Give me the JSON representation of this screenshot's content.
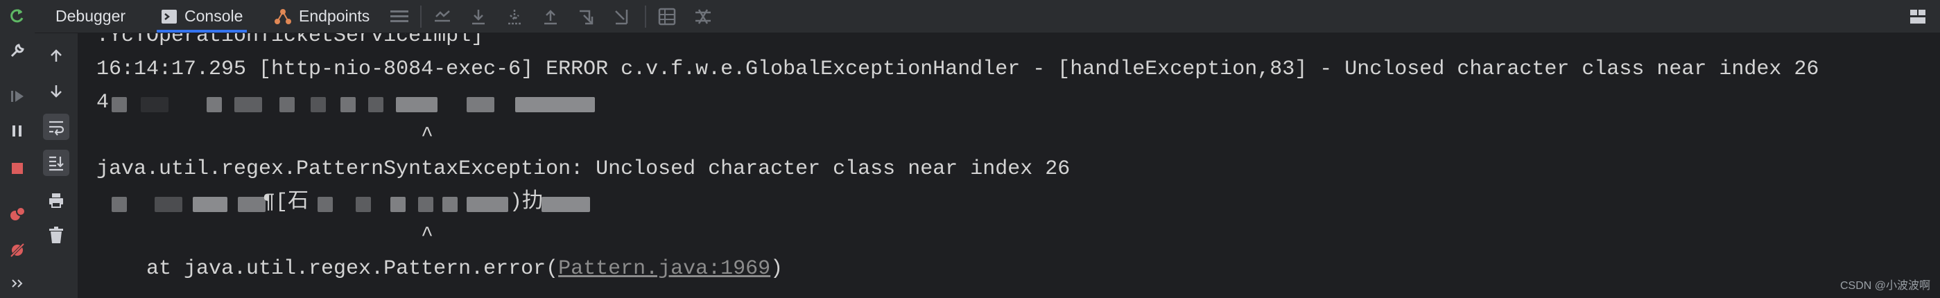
{
  "tabs": [
    {
      "label": "Debugger",
      "icon": "none"
    },
    {
      "label": "Console",
      "icon": "console-icon",
      "active": true
    },
    {
      "label": "Endpoints",
      "icon": "endpoints-icon"
    }
  ],
  "console": {
    "partial_top": ".YcTOperationTicketServiceImpl]",
    "error_line": "16:14:17.295 [http-nio-8084-exec-6] ERROR c.v.f.w.e.GlobalExceptionHandler - [handleException,83] - Unclosed character class near index 26",
    "line2_prefix": "4",
    "caret1": "^",
    "exception_line": "java.util.regex.PatternSyntaxException: Unclosed character class near index 26",
    "line5_fragment_a": "¶[石",
    "line5_fragment_b": ")扐",
    "caret2": "^",
    "stack_prefix": "    at java.util.regex.Pattern.error(",
    "stack_link": "Pattern.java:1969",
    "stack_suffix": ")"
  },
  "watermark": "CSDN @小波波啊",
  "colors": {
    "accent": "#3574f0",
    "rerun": "#5fb865",
    "stop": "#db5c5c"
  }
}
